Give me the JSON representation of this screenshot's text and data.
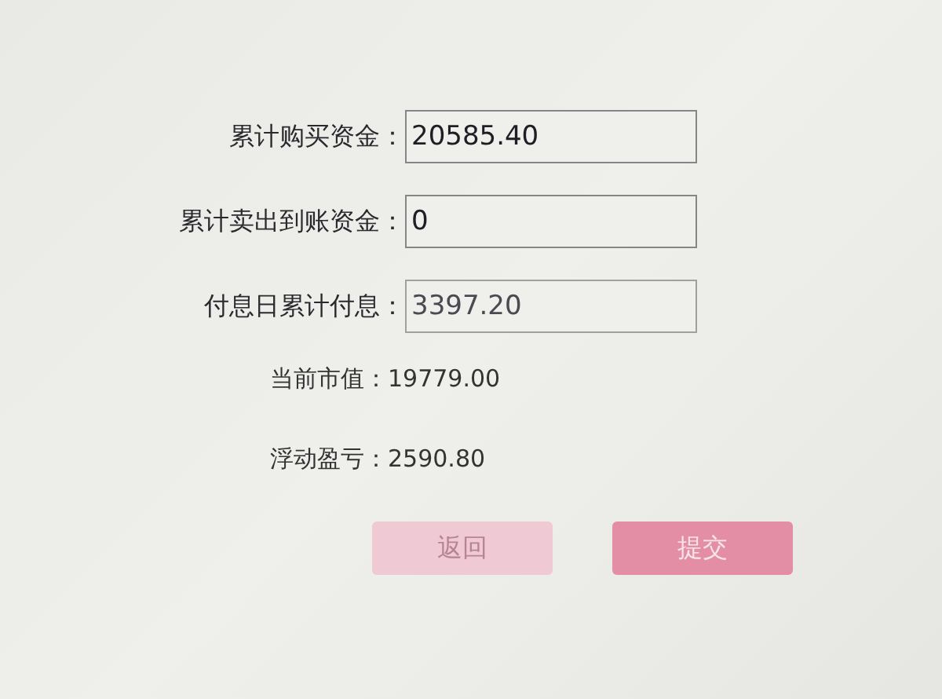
{
  "fields": [
    {
      "label": "累计购买资金：",
      "value": "20585.40",
      "disabled": false
    },
    {
      "label": "累计卖出到账资金：",
      "value": "0",
      "disabled": false
    },
    {
      "label": "付息日累计付息：",
      "value": "3397.20",
      "disabled": true
    }
  ],
  "info": [
    {
      "label": "当前市值：",
      "value": "19779.00"
    },
    {
      "label": "浮动盈亏：",
      "value": "2590.80"
    }
  ],
  "buttons": [
    {
      "label": "返回",
      "disabled": true
    },
    {
      "label": "提交",
      "disabled": false
    }
  ]
}
